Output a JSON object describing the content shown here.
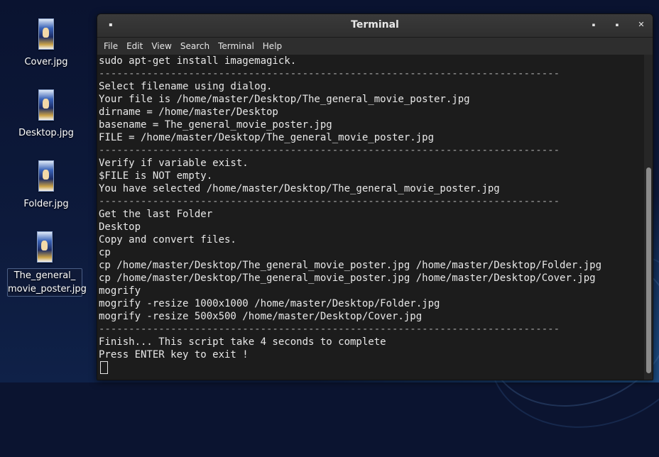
{
  "window": {
    "title": "Terminal",
    "menu_glyph": "▪",
    "minimize_glyph": "▪",
    "maximize_glyph": "▪",
    "close_glyph": "✕"
  },
  "menu": [
    "File",
    "Edit",
    "View",
    "Search",
    "Terminal",
    "Help"
  ],
  "desktop_icons": [
    {
      "label": "Cover.jpg"
    },
    {
      "label": "Desktop.jpg"
    },
    {
      "label": "Folder.jpg"
    },
    {
      "label": "The_general_ movie_poster.jpg"
    }
  ],
  "terminal_lines": [
    "sudo apt-get install imagemagick.",
    "-----------------------------------------------------------------------------",
    "Select filename using dialog.",
    "Your file is /home/master/Desktop/The_general_movie_poster.jpg",
    "dirname = /home/master/Desktop",
    "basename = The_general_movie_poster.jpg",
    "FILE = /home/master/Desktop/The_general_movie_poster.jpg",
    "-----------------------------------------------------------------------------",
    "Verify if variable exist.",
    "$FILE is NOT empty.",
    "You have selected /home/master/Desktop/The_general_movie_poster.jpg",
    "-----------------------------------------------------------------------------",
    "Get the last Folder",
    "Desktop",
    "Copy and convert files.",
    "cp",
    "cp /home/master/Desktop/The_general_movie_poster.jpg /home/master/Desktop/Folder.jpg",
    "cp /home/master/Desktop/The_general_movie_poster.jpg /home/master/Desktop/Cover.jpg",
    "mogrify",
    "mogrify -resize 1000x1000 /home/master/Desktop/Folder.jpg",
    "mogrify -resize 500x500 /home/master/Desktop/Cover.jpg",
    "-----------------------------------------------------------------------------",
    "Finish... This script take 4 seconds to complete",
    "Press ENTER key to exit !"
  ]
}
